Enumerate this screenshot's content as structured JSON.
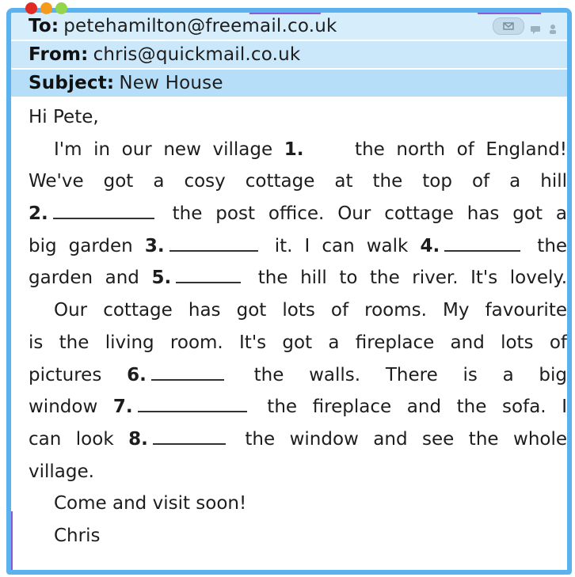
{
  "header": {
    "to_label": "To:",
    "to_value": "petehamilton@freemail.co.uk",
    "from_label": "From:",
    "from_value": "chris@quickmail.co.uk",
    "subject_label": "Subject:",
    "subject_value": "New House",
    "icons": [
      "envelope-icon",
      "chat-icon",
      "person-icon"
    ]
  },
  "window_controls": [
    "close",
    "minimize",
    "maximize"
  ],
  "body": {
    "greeting": "Hi Pete,",
    "p1_l1_a": "I'm in our new village",
    "n1": "1.",
    "p1_l1_b": "the north of England!",
    "p1_l2": "We've got a cosy cottage at the top of a hill",
    "n2": "2.",
    "p1_l3_b": "the post office. Our cottage has got a",
    "p1_l4_a": "big garden",
    "n3": "3.",
    "p1_l4_b": "it. I can walk",
    "n4": "4.",
    "p1_l4_c": "the",
    "p1_l5_a": "garden and",
    "n5": "5.",
    "p1_l5_b": "the hill to the river. It's lovely.",
    "p2_l1": "Our cottage has got lots of rooms. My favourite",
    "p2_l2": "is the living room. It's got a fireplace and lots of",
    "p2_l3_a": "pictures",
    "n6": "6.",
    "p2_l3_b": "the walls. There is a big",
    "p2_l4_a": "window",
    "n7": "7.",
    "p2_l4_b": "the fireplace and the sofa. I",
    "p2_l5_a": "can look",
    "n8": "8.",
    "p2_l5_b": "the window and see the whole",
    "p2_l6": "village.",
    "closing": "Come and visit soon!",
    "signature": "Chris"
  }
}
